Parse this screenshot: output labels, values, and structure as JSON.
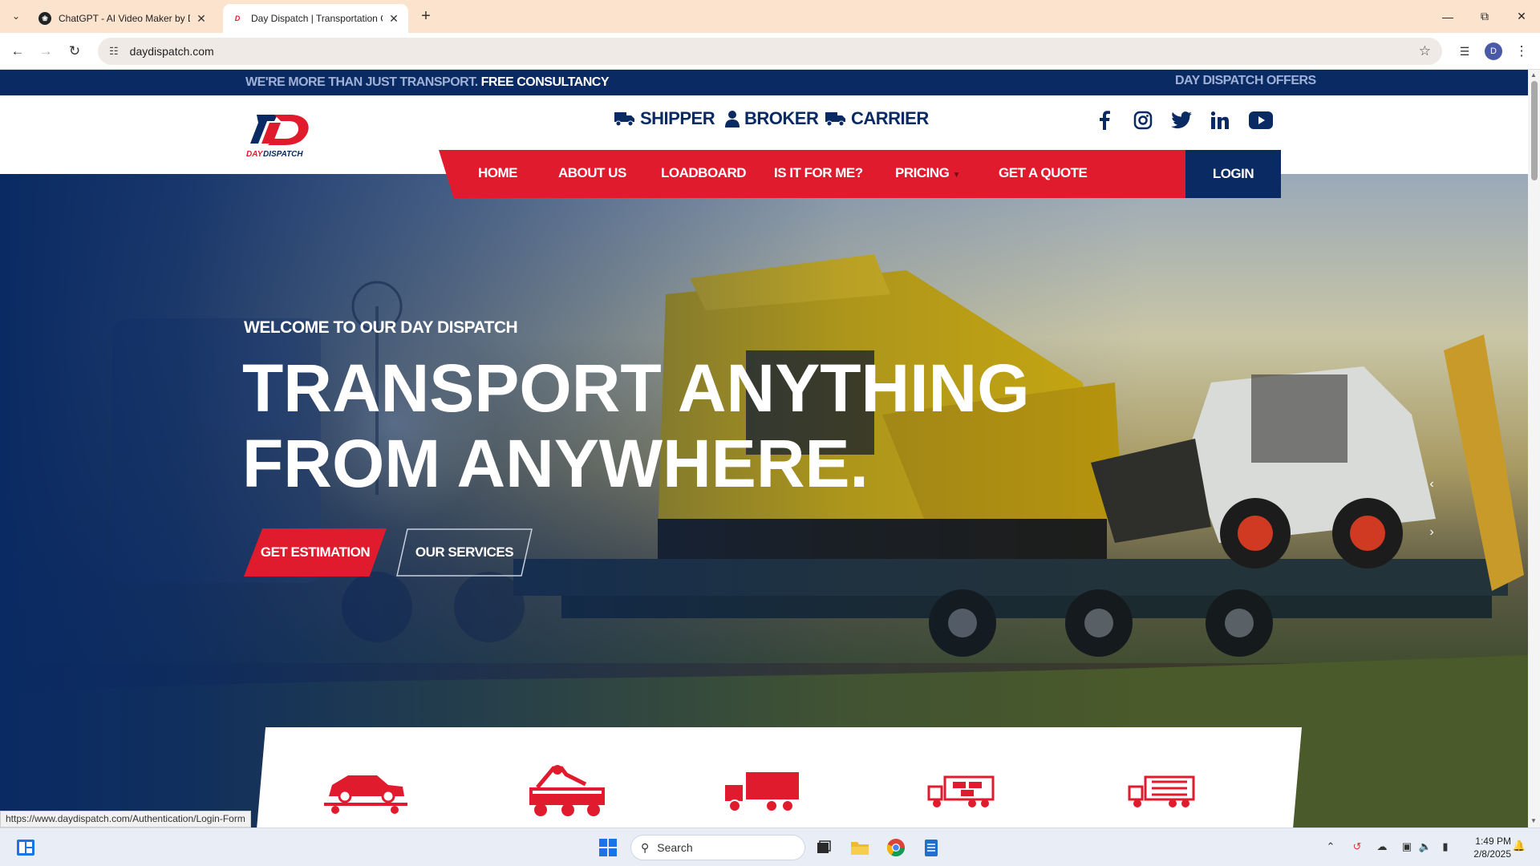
{
  "browser": {
    "tabs": [
      {
        "title": "ChatGPT - AI Video Maker by D",
        "favicon": "chatgpt-icon"
      },
      {
        "title": "Day Dispatch | Transportation C",
        "favicon": "daydispatch-icon"
      }
    ],
    "url": "daydispatch.com",
    "profile_initial": "D",
    "status_url": "https://www.daydispatch.com/Authentication/Login-Form"
  },
  "site": {
    "topbar": {
      "tagline": "WE'RE MORE THAN JUST TRANSPORT.",
      "tagline_strong": "FREE CONSULTANCY",
      "offers": "DAY DISPATCH OFFERS"
    },
    "logo_text": "DAYDISPATCH",
    "role_links": [
      {
        "label": "SHIPPER",
        "icon": "truck-icon"
      },
      {
        "label": "BROKER",
        "icon": "user-icon"
      },
      {
        "label": "CARRIER",
        "icon": "truck-icon"
      }
    ],
    "social": [
      "facebook-icon",
      "instagram-icon",
      "twitter-icon",
      "linkedin-icon",
      "youtube-icon"
    ],
    "nav": {
      "home": "HOME",
      "about": "ABOUT US",
      "loadboard": "LOADBOARD",
      "isitforme": "IS IT FOR ME?",
      "pricing": "PRICING",
      "quote": "GET A QUOTE",
      "login": "LOGIN"
    },
    "hero": {
      "welcome": "WELCOME TO OUR DAY DISPATCH",
      "headline_line1": "TRANSPORT ANYTHING",
      "headline_line2": "FROM ANYWHERE.",
      "btn_estimation": "GET ESTIMATION",
      "btn_services": "OUR SERVICES"
    },
    "service_icons": [
      "car-carrier-icon",
      "tow-truck-icon",
      "box-truck-icon",
      "freight-truck-icon",
      "container-truck-icon"
    ]
  },
  "taskbar": {
    "search_placeholder": "Search",
    "time": "1:49 PM",
    "date": "2/8/2025"
  },
  "colors": {
    "brand_red": "#e11b2e",
    "brand_navy": "#0a2a63",
    "chrome_tab": "#fbe3cd"
  }
}
